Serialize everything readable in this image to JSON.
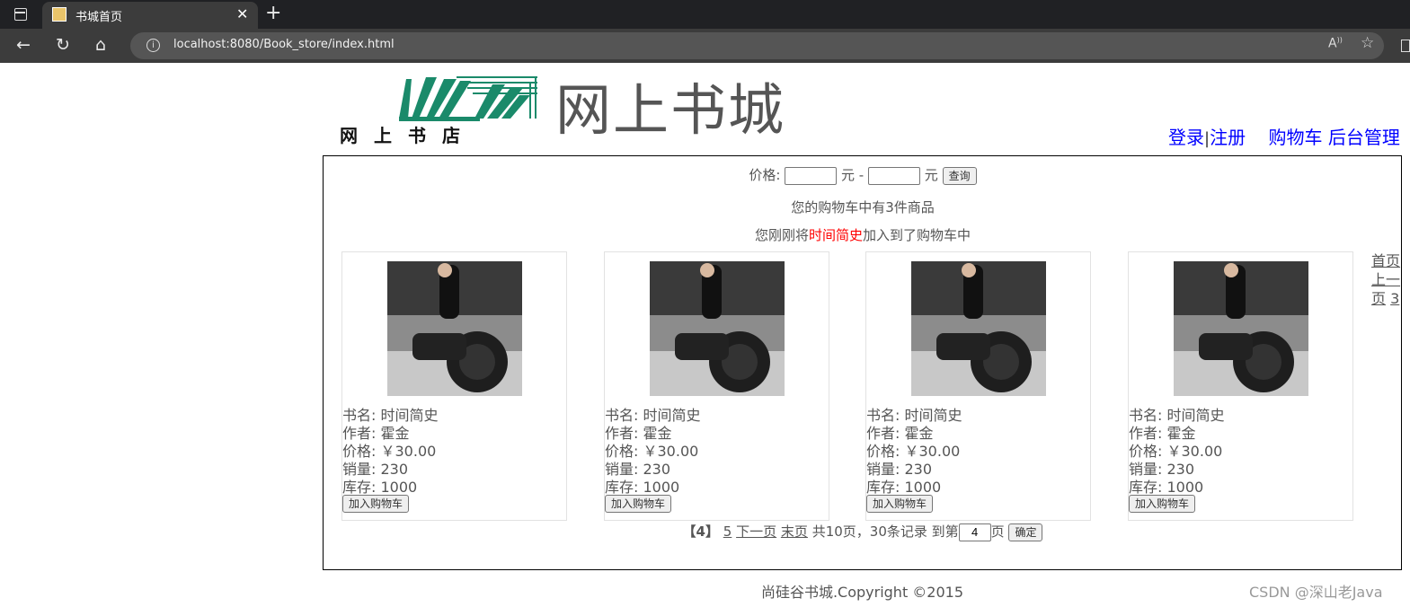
{
  "browser": {
    "tab_title": "书城首页",
    "tab_close": "✕",
    "new_tab": "+",
    "url": "localhost:8080/Book_store/index.html",
    "icons": [
      "back-arrow-icon",
      "reload-icon",
      "home-icon",
      "info-icon",
      "read-aloud-icon",
      "favorites-icon"
    ]
  },
  "header": {
    "logo_text": "网上书店",
    "site_title": "网上书城",
    "login": "登录",
    "separator": "|",
    "register": "注册",
    "cart": "购物车",
    "admin": "后台管理",
    "link_color": "#0000ff"
  },
  "search": {
    "price_label": "价格:",
    "unit1": "元 -",
    "unit2": "元",
    "query_button": "查询",
    "min_value": "",
    "max_value": ""
  },
  "cart_info": {
    "count_text": "您的购物车中有3件商品",
    "last_added_prefix": "您刚刚将",
    "last_added_book": "时间简史",
    "last_added_suffix": "加入到了购物车中"
  },
  "books": [
    {
      "name_label": "书名:",
      "name": "时间简史",
      "author_label": "作者:",
      "author": "霍金",
      "price_label": "价格:",
      "price": "￥30.00",
      "sales_label": "销量:",
      "sales": "230",
      "stock_label": "库存:",
      "stock": "1000",
      "button": "加入购物车"
    },
    {
      "name_label": "书名:",
      "name": "时间简史",
      "author_label": "作者:",
      "author": "霍金",
      "price_label": "价格:",
      "price": "￥30.00",
      "sales_label": "销量:",
      "sales": "230",
      "stock_label": "库存:",
      "stock": "1000",
      "button": "加入购物车"
    },
    {
      "name_label": "书名:",
      "name": "时间简史",
      "author_label": "作者:",
      "author": "霍金",
      "price_label": "价格:",
      "price": "￥30.00",
      "sales_label": "销量:",
      "sales": "230",
      "stock_label": "库存:",
      "stock": "1000",
      "button": "加入购物车"
    },
    {
      "name_label": "书名:",
      "name": "时间简史",
      "author_label": "作者:",
      "author": "霍金",
      "price_label": "价格:",
      "price": "￥30.00",
      "sales_label": "销量:",
      "sales": "230",
      "stock_label": "库存:",
      "stock": "1000",
      "button": "加入购物车"
    }
  ],
  "side_pager": {
    "first": "首页",
    "prev_a": "上一",
    "prev_b": "页",
    "num": "3"
  },
  "pager": {
    "current": "【4】",
    "next_num": "5",
    "next": "下一页",
    "last": "末页",
    "summary": "共10页，30条记录 到第",
    "page_value": "4",
    "page_suffix": "页",
    "confirm": "确定"
  },
  "footer": {
    "copyright": "尚硅谷书城.Copyright ©2015",
    "watermark": "CSDN @深山老Java"
  }
}
